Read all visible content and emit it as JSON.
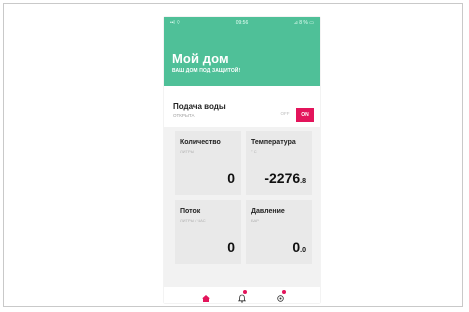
{
  "status_bar": {
    "left": "••l ⌔",
    "time": "09:56",
    "right": "⊿ 8 % ▭"
  },
  "header": {
    "title": "Мой дом",
    "subtitle": "ВАШ ДОМ ПОД ЗАЩИТОЙ!"
  },
  "water_supply": {
    "title": "Подача воды",
    "status": "ОТКРЫТА",
    "toggle": {
      "off_label": "OFF",
      "on_label": "ON",
      "state": "on"
    }
  },
  "cards": [
    {
      "name": "Количество",
      "unit": "ЛИТРЫ",
      "value": "0",
      "decimal": ""
    },
    {
      "name": "Температура",
      "unit": "° C",
      "value": "-2276",
      "decimal": ".8"
    },
    {
      "name": "Поток",
      "unit": "ЛИТРЫ / ЧАС",
      "value": "0",
      "decimal": ""
    },
    {
      "name": "Давление",
      "unit": "БАР",
      "value": "0",
      "decimal": ".0"
    }
  ],
  "nav": {
    "items": [
      {
        "icon": "home-icon",
        "active": true
      },
      {
        "icon": "bell-icon",
        "badge": true
      },
      {
        "icon": "settings-icon",
        "badge": true
      }
    ]
  },
  "colors": {
    "header": "#4fc098",
    "accent": "#e3145b",
    "card": "#e9e9e9"
  }
}
